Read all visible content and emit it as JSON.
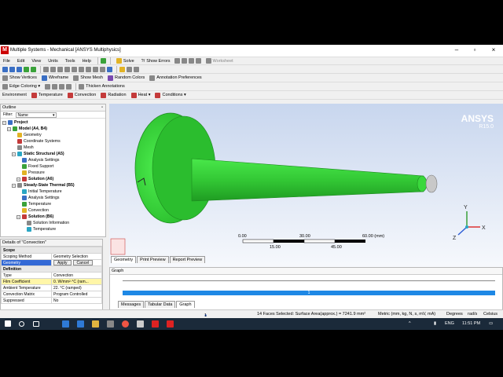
{
  "window": {
    "title": "Multiple Systems - Mechanical [ANSYS Multiphysics]"
  },
  "menu": [
    "File",
    "Edit",
    "View",
    "Units",
    "Tools",
    "Help"
  ],
  "toolbar1": {
    "solve": "Solve",
    "show_errors": "Show Errors",
    "worksheet": "Worksheet"
  },
  "toolbar3": [
    "Show Vertices",
    "Wireframe",
    "Show Mesh",
    "Random Colors",
    "Annotation Preferences"
  ],
  "toolbar4": [
    "Edge Coloring",
    "Thicken Annotations"
  ],
  "toolbar5": [
    "Environment",
    "Temperature",
    "Convection",
    "Radiation",
    "Heat",
    "Conditions"
  ],
  "outline": {
    "header": "Outline",
    "filter_label": "Filter:",
    "filter_value": "Name",
    "tree": [
      {
        "label": "Project",
        "level": 0,
        "bold": true
      },
      {
        "label": "Model (A4, B4)",
        "level": 1,
        "bold": true
      },
      {
        "label": "Geometry",
        "level": 2
      },
      {
        "label": "Coordinate Systems",
        "level": 2
      },
      {
        "label": "Mesh",
        "level": 2
      },
      {
        "label": "Static Structural (A5)",
        "level": 2,
        "bold": true
      },
      {
        "label": "Analysis Settings",
        "level": 3
      },
      {
        "label": "Fixed Support",
        "level": 3
      },
      {
        "label": "Pressure",
        "level": 3
      },
      {
        "label": "Solution (A6)",
        "level": 3,
        "bold": true
      },
      {
        "label": "Steady-State Thermal (B5)",
        "level": 2,
        "bold": true
      },
      {
        "label": "Initial Temperature",
        "level": 3
      },
      {
        "label": "Analysis Settings",
        "level": 3
      },
      {
        "label": "Temperature",
        "level": 3
      },
      {
        "label": "Convection",
        "level": 3
      },
      {
        "label": "Solution (B6)",
        "level": 3,
        "bold": true
      },
      {
        "label": "Solution Information",
        "level": 4
      },
      {
        "label": "Temperature",
        "level": 4
      }
    ]
  },
  "details": {
    "header": "Details of \"Convection\"",
    "rows": [
      {
        "type": "group",
        "k": "Scope"
      },
      {
        "k": "Scoping Method",
        "v": "Geometry Selection"
      },
      {
        "k": "Geometry",
        "v": "",
        "apply": "Apply",
        "cancel": "Cancel",
        "selected": true
      },
      {
        "type": "group",
        "k": "Definition"
      },
      {
        "k": "Type",
        "v": "Convection"
      },
      {
        "k": "Film Coefficient",
        "v": "0. W/mm²·°C  (ram...",
        "yellow": true
      },
      {
        "k": "Ambient Temperature",
        "v": "22. °C  (ramped)"
      },
      {
        "k": "Convection Matrix",
        "v": "Program Controlled"
      },
      {
        "k": "Suppressed",
        "v": "No"
      }
    ]
  },
  "viewport": {
    "brand": "ANSYS",
    "version": "R15.0",
    "scale_top": [
      "0.00",
      "30.00",
      "60.00 (mm)"
    ],
    "scale_bottom": [
      "15.00",
      "45.00"
    ],
    "axis": [
      "Y",
      "X",
      "Z"
    ],
    "tabs": [
      "Geometry",
      "Print Preview",
      "Report Preview"
    ]
  },
  "graph": {
    "header": "Graph",
    "marker": "1",
    "tabs": [
      "Messages",
      "Tabular Data",
      "Graph"
    ]
  },
  "status": {
    "messages": "1 Message",
    "selection": "14 Faces Selected: Surface Area(approx.) = 7241.9 mm²",
    "units": "Metric (mm, kg, N, s, mV, mA)",
    "angle": "Degrees",
    "rate": "rad/s",
    "temp": "Celsius"
  },
  "taskbar": {
    "lang": "ENG",
    "time": "11:51 PM"
  },
  "colors": {
    "model": "#39d23c",
    "accent": "#3369d6",
    "graph_bar": "#1e88e5"
  }
}
